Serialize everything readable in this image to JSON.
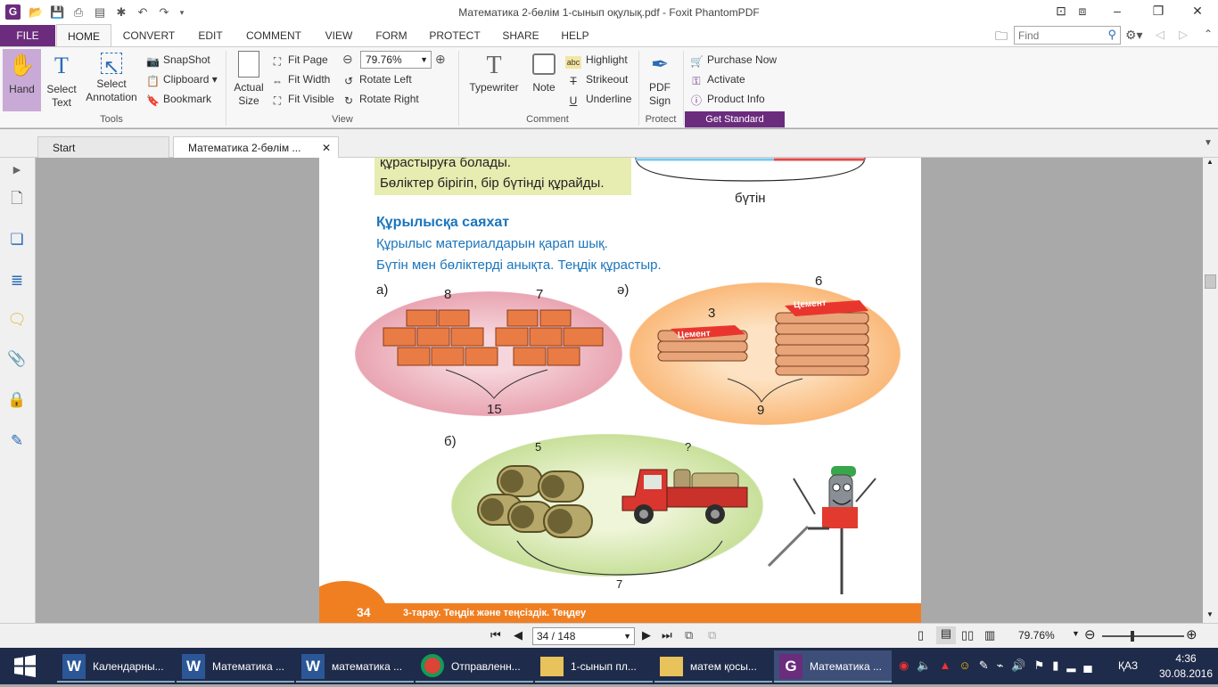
{
  "window": {
    "title": "Математика 2-бөлім 1-сынып оқулық.pdf - Foxit PhantomPDF"
  },
  "ribbon_tabs": [
    "FILE",
    "HOME",
    "CONVERT",
    "EDIT",
    "COMMENT",
    "VIEW",
    "FORM",
    "PROTECT",
    "SHARE",
    "HELP"
  ],
  "search": {
    "placeholder": "Find"
  },
  "tools": {
    "hand": "Hand",
    "select_text": "Select Text",
    "select_annotation": "Select Annotation",
    "snapshot": "SnapShot",
    "clipboard": "Clipboard",
    "bookmark": "Bookmark",
    "group": "Tools"
  },
  "view": {
    "actual_size": "Actual Size",
    "fit_page": "Fit Page",
    "fit_width": "Fit Width",
    "fit_visible": "Fit Visible",
    "zoom": "79.76%",
    "rotate_left": "Rotate Left",
    "rotate_right": "Rotate Right",
    "group": "View"
  },
  "comment": {
    "typewriter": "Typewriter",
    "note": "Note",
    "highlight": "Highlight",
    "strikeout": "Strikeout",
    "underline": "Underline",
    "group": "Comment",
    "abc": "abc"
  },
  "protect": {
    "pdf_sign": "PDF Sign",
    "group": "Protect"
  },
  "purchase": {
    "purchase_now": "Purchase Now",
    "activate": "Activate",
    "product_info": "Product Info",
    "get_standard": "Get Standard"
  },
  "doc_tabs": [
    "Start",
    "Математика 2-бөлім ..."
  ],
  "page": {
    "top_line1": "құрастыруға болады.",
    "top_line2": "Бөліктер бірігіп, бір бүтінді құрайды.",
    "whole_label": "бүтін",
    "heading": "Құрылысқа саяхат",
    "instr1": "Құрылыс материалдарын қарап шық.",
    "instr2": "Бүтін мен бөліктерді анықта. Теңдік құрастыр.",
    "a_label": "а)",
    "ae_label": "ә)",
    "b_label": "б)",
    "bricks_left": "8",
    "bricks_right": "7",
    "bricks_total": "15",
    "cement_left": "3",
    "cement_right": "6",
    "cement_total": "9",
    "cement_word": "Цемент",
    "pipes": "5",
    "truck": "?",
    "pipes_total": "7",
    "page_num": "34",
    "footer": "3-тарау. Теңдік және теңсіздік. Теңдеу"
  },
  "status": {
    "page_field": "34 / 148",
    "zoom": "79.76%"
  },
  "taskbar": {
    "items": [
      "Календарны...",
      "Математика ...",
      "математика ...",
      "Отправленн...",
      "1-сынып пл...",
      "матем қосы...",
      "Математика ..."
    ],
    "lang": "ҚАЗ",
    "time": "4:36",
    "date": "30.08.2016"
  }
}
